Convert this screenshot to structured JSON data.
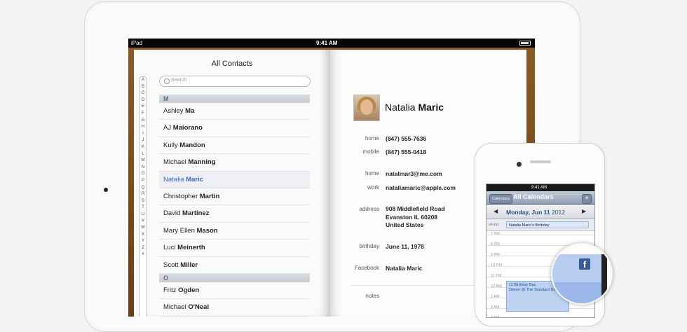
{
  "ipad": {
    "status": {
      "carrier": "iPad",
      "time": "9:41 AM"
    },
    "left": {
      "title": "All Contacts",
      "search_placeholder": "Search",
      "index": [
        "A",
        "B",
        "C",
        "D",
        "E",
        "F",
        "G",
        "H",
        "I",
        "J",
        "K",
        "L",
        "M",
        "N",
        "O",
        "P",
        "Q",
        "R",
        "S",
        "T",
        "U",
        "V",
        "W",
        "X",
        "Y",
        "Z",
        "#"
      ],
      "sections": [
        {
          "letter": "M",
          "rows": [
            {
              "first": "Ashley",
              "last": "Ma"
            },
            {
              "first": "AJ",
              "last": "Maiorano"
            },
            {
              "first": "Kully",
              "last": "Mandon"
            },
            {
              "first": "Michael",
              "last": "Manning"
            },
            {
              "first": "Natalia",
              "last": "Maric",
              "selected": true
            },
            {
              "first": "Christopher",
              "last": "Martin"
            },
            {
              "first": "David",
              "last": "Martinez"
            },
            {
              "first": "Mary Ellen",
              "last": "Mason"
            },
            {
              "first": "Luci",
              "last": "Meinerth"
            },
            {
              "first": "Scott",
              "last": "Miller"
            }
          ]
        },
        {
          "letter": "O",
          "rows": [
            {
              "first": "Fritz",
              "last": "Ogden"
            },
            {
              "first": "Michael",
              "last": "O'Neal"
            }
          ]
        }
      ]
    },
    "right": {
      "first": "Natalia",
      "last": "Maric",
      "fields": {
        "home_phone_label": "home",
        "home_phone": "(847) 555-7636",
        "mobile_label": "mobile",
        "mobile": "(847) 555-0418",
        "home_email_label": "home",
        "home_email": "natalmar3@me.com",
        "work_email_label": "work",
        "work_email": "nataliamaric@apple.com",
        "address_label": "address",
        "address_line1": "908 Middlefield Road",
        "address_line2": "Evanston IL 60208",
        "address_line3": "United States",
        "birthday_label": "birthday",
        "birthday": "June 11, 1978",
        "facebook_label": "Facebook",
        "facebook": "Natalia Maric",
        "notes_label": "notes"
      }
    }
  },
  "iphone": {
    "status_time": "9:41 AM",
    "calendars_button": "Calendars",
    "title": "All Calendars",
    "plus": "+",
    "day": "Monday, Jun 11",
    "year": "2012",
    "allday_label": "all-day",
    "allday_event": "Natalia Maric's Birthday",
    "hours": [
      "7 PM",
      "8 PM",
      "9 PM",
      "10 PM",
      "11 PM",
      "12 AM",
      "1 AM",
      "2 AM",
      "3 AM",
      "4 AM"
    ],
    "event_title": "11 Birthday Bas",
    "event_sub": "Dinner @ The Standard Do"
  },
  "zoom": {
    "facebook_glyph": "f"
  }
}
